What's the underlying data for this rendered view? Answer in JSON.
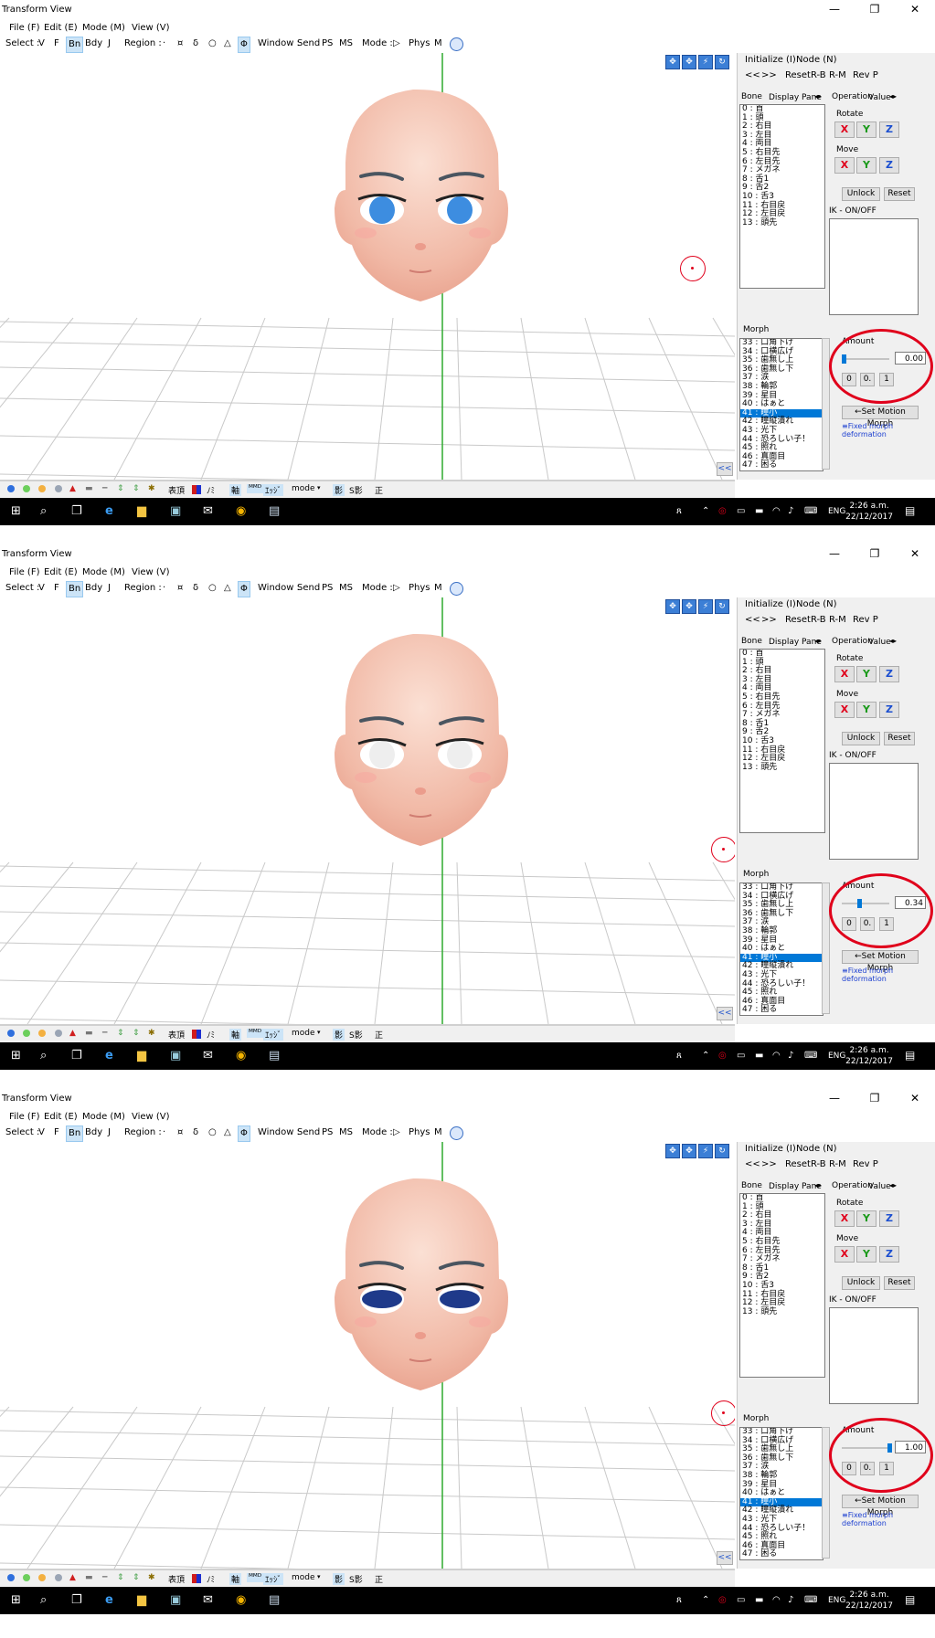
{
  "window_title": "Transform View",
  "menu": [
    "File (F)",
    "Edit (E)",
    "Mode (M)",
    "View (V)"
  ],
  "toolbar": {
    "select_label": "Select :",
    "select_items": [
      "V",
      "F",
      "Bn",
      "Bdy",
      "J"
    ],
    "region_label": "Region :",
    "region_items": [
      "·",
      "¤",
      "δ",
      "○",
      "△",
      "Φ"
    ],
    "window_label": "Window :",
    "window_items": [
      "Send",
      "PS",
      "MS"
    ],
    "mode_label": "Mode :",
    "mode_items": [
      "▷",
      "Phys",
      "M"
    ]
  },
  "panel": {
    "initialize": "Initialize (I)",
    "node": "Node (N)",
    "nav_prev": "<<",
    "nav_next": ">>",
    "reset": "Reset",
    "rb": "R-B",
    "rm": "R-M",
    "revp": "Rev P",
    "tab_bone": "Bone",
    "tab_display": "Display Pane",
    "tab_operation": "Operation",
    "tab_value": "Value",
    "rotate": "Rotate",
    "move": "Move",
    "x": "X",
    "y": "Y",
    "z": "Z",
    "unlock": "Unlock",
    "reset_btn": "Reset",
    "ik": "IK - ON/OFF",
    "morph": "Morph",
    "amount": "Amount",
    "btn0": "0",
    "btn05": "0.",
    "btn1": "1",
    "set_motion": "←Set Motion Morph",
    "fixed_morph": "≡Fixed morph deformation",
    "collapse": "<<"
  },
  "bones": [
    "0 : 首",
    "1 : 頭",
    "2 : 右目",
    "3 : 左目",
    "4 : 両目",
    "5 : 右目先",
    "6 : 左目先",
    "7 : メガネ",
    "8 : 舌1",
    "9 : 舌2",
    "10 : 舌3",
    "11 : 右目戻",
    "12 : 左目戻",
    "13 : 頭先"
  ],
  "morphs": [
    "33 : 口角下げ",
    "34 : 口横広げ",
    "35 : 歯無し上",
    "36 : 歯無し下",
    "37 : 涙",
    "38 : 輪郭",
    "39 : 星目",
    "40 : はぁと",
    "41 : 瞳小",
    "42 : 瞳縦潰れ",
    "43 : 光下",
    "44 : 恐ろしい子！",
    "45 : 照れ",
    "46 : 真面目",
    "47 : 困る"
  ],
  "selected_morph_index": 8,
  "bottombar": {
    "hyocho": "表頂",
    "nomi": "ﾉﾐ",
    "axis": "軸",
    "mo": "ᴹᴹᴰ",
    "edge": "ｴｯｼﾞ",
    "mode": "mode",
    "shadow": "影",
    "sshadow": "S影",
    "sei": "正"
  },
  "taskbar": {
    "lang": "ENG",
    "time": "2:26 a.m.",
    "date": "22/12/2017"
  },
  "frames": [
    {
      "amount": 0.0,
      "amount_text": "0.00",
      "eye": "blue"
    },
    {
      "amount": 0.34,
      "amount_text": "0.34",
      "eye": "white"
    },
    {
      "amount": 1.0,
      "amount_text": "1.00",
      "eye": "dark"
    }
  ],
  "colors": {
    "highlight": "#0078d7",
    "red": "#e0001b",
    "grid": "#c9c9c9",
    "axis_green": "#2faa2f",
    "skin": "#f4c3b0"
  }
}
